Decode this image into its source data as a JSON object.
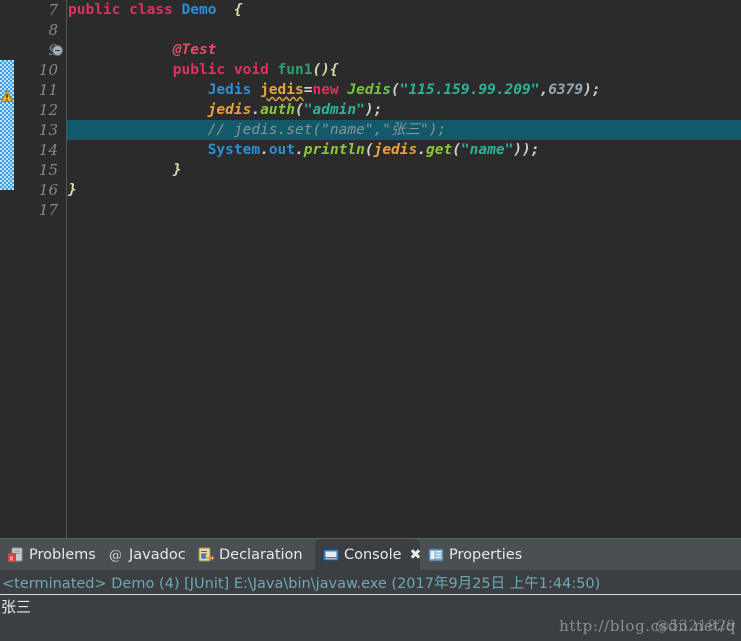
{
  "editor": {
    "first_line": 7,
    "lines": [
      {
        "num": 7,
        "fold": false,
        "warn": false,
        "highlight": false,
        "tokens": [
          {
            "t": "public ",
            "c": "kw"
          },
          {
            "t": "class ",
            "c": "kw"
          },
          {
            "t": "Demo",
            "c": "type"
          },
          {
            "t": "  ",
            "c": "plain"
          },
          {
            "t": "{",
            "c": "brace"
          }
        ]
      },
      {
        "num": 8,
        "fold": false,
        "warn": false,
        "highlight": false,
        "tokens": []
      },
      {
        "num": 9,
        "fold": true,
        "warn": false,
        "highlight": false,
        "tokens": [
          {
            "t": "            ",
            "c": "plain"
          },
          {
            "t": "@Test",
            "c": "anno"
          }
        ]
      },
      {
        "num": 10,
        "fold": false,
        "warn": false,
        "highlight": false,
        "tokens": [
          {
            "t": "            ",
            "c": "plain"
          },
          {
            "t": "public ",
            "c": "kw"
          },
          {
            "t": "void ",
            "c": "kw"
          },
          {
            "t": "fun1",
            "c": "meth"
          },
          {
            "t": "()",
            "c": "brace"
          },
          {
            "t": "{",
            "c": "brace"
          }
        ]
      },
      {
        "num": 11,
        "fold": false,
        "warn": true,
        "highlight": false,
        "tokens": [
          {
            "t": "                ",
            "c": "plain"
          },
          {
            "t": "Jedis ",
            "c": "type"
          },
          {
            "t": "jedis",
            "c": "varU"
          },
          {
            "t": "=",
            "c": "punct"
          },
          {
            "t": "new ",
            "c": "kw"
          },
          {
            "t": "Jedis",
            "c": "typeG"
          },
          {
            "t": "(",
            "c": "punct"
          },
          {
            "t": "\"115.159.99.209\"",
            "c": "str"
          },
          {
            "t": ",",
            "c": "punct"
          },
          {
            "t": "6379",
            "c": "num"
          },
          {
            "t": ");",
            "c": "punct"
          }
        ]
      },
      {
        "num": 12,
        "fold": false,
        "warn": false,
        "highlight": false,
        "tokens": [
          {
            "t": "                ",
            "c": "plain"
          },
          {
            "t": "jedis",
            "c": "var"
          },
          {
            "t": ".",
            "c": "punct"
          },
          {
            "t": "auth",
            "c": "methI"
          },
          {
            "t": "(",
            "c": "punct"
          },
          {
            "t": "\"admin\"",
            "c": "str"
          },
          {
            "t": ");",
            "c": "punct"
          }
        ]
      },
      {
        "num": 13,
        "fold": false,
        "warn": false,
        "highlight": true,
        "tokens": [
          {
            "t": "                ",
            "c": "plain"
          },
          {
            "t": "// jedis.set(\"name\",\"张三\");",
            "c": "cmt"
          }
        ]
      },
      {
        "num": 14,
        "fold": false,
        "warn": false,
        "highlight": false,
        "tokens": [
          {
            "t": "                ",
            "c": "plain"
          },
          {
            "t": "System",
            "c": "type"
          },
          {
            "t": ".",
            "c": "punct"
          },
          {
            "t": "out",
            "c": "type"
          },
          {
            "t": ".",
            "c": "punct"
          },
          {
            "t": "println",
            "c": "methI"
          },
          {
            "t": "(",
            "c": "punct"
          },
          {
            "t": "jedis",
            "c": "var"
          },
          {
            "t": ".",
            "c": "punct"
          },
          {
            "t": "get",
            "c": "methI"
          },
          {
            "t": "(",
            "c": "punct"
          },
          {
            "t": "\"name\"",
            "c": "str"
          },
          {
            "t": "));",
            "c": "punct"
          }
        ]
      },
      {
        "num": 15,
        "fold": false,
        "warn": false,
        "highlight": false,
        "tokens": [
          {
            "t": "            ",
            "c": "plain"
          },
          {
            "t": "}",
            "c": "brace"
          }
        ]
      },
      {
        "num": 16,
        "fold": false,
        "warn": false,
        "highlight": false,
        "tokens": [
          {
            "t": "}",
            "c": "brace"
          }
        ]
      },
      {
        "num": 17,
        "fold": false,
        "warn": false,
        "highlight": false,
        "tokens": []
      }
    ]
  },
  "panel": {
    "tabs": [
      {
        "label": "Problems",
        "icon": "problems-icon",
        "active": false,
        "closable": false
      },
      {
        "label": "Javadoc",
        "icon": "javadoc-icon",
        "active": false,
        "closable": false
      },
      {
        "label": "Declaration",
        "icon": "declaration-icon",
        "active": false,
        "closable": false
      },
      {
        "label": "Console",
        "icon": "console-icon",
        "active": true,
        "closable": true
      },
      {
        "label": "Properties",
        "icon": "properties-icon",
        "active": false,
        "closable": false
      }
    ],
    "close_glyph": "✖",
    "console": {
      "terminated_line": "<terminated> Demo (4) [JUnit] E:\\Java\\bin\\javaw.exe (2017年9月25日 上午1:44:50)",
      "output": "张三"
    }
  },
  "watermark": {
    "line_front": "http://blog.csdn.net/q",
    "line_back": "@5321829"
  },
  "colors": {
    "editor_bg": "#2b2b2b",
    "panel_bg": "#3c3f41",
    "tabbar_bg": "#4a4f52",
    "highlight_row": "#11596b",
    "line_number": "#808b8f",
    "terminated_text": "#6ea8b4",
    "marker_blue": "#3a9ae0"
  }
}
